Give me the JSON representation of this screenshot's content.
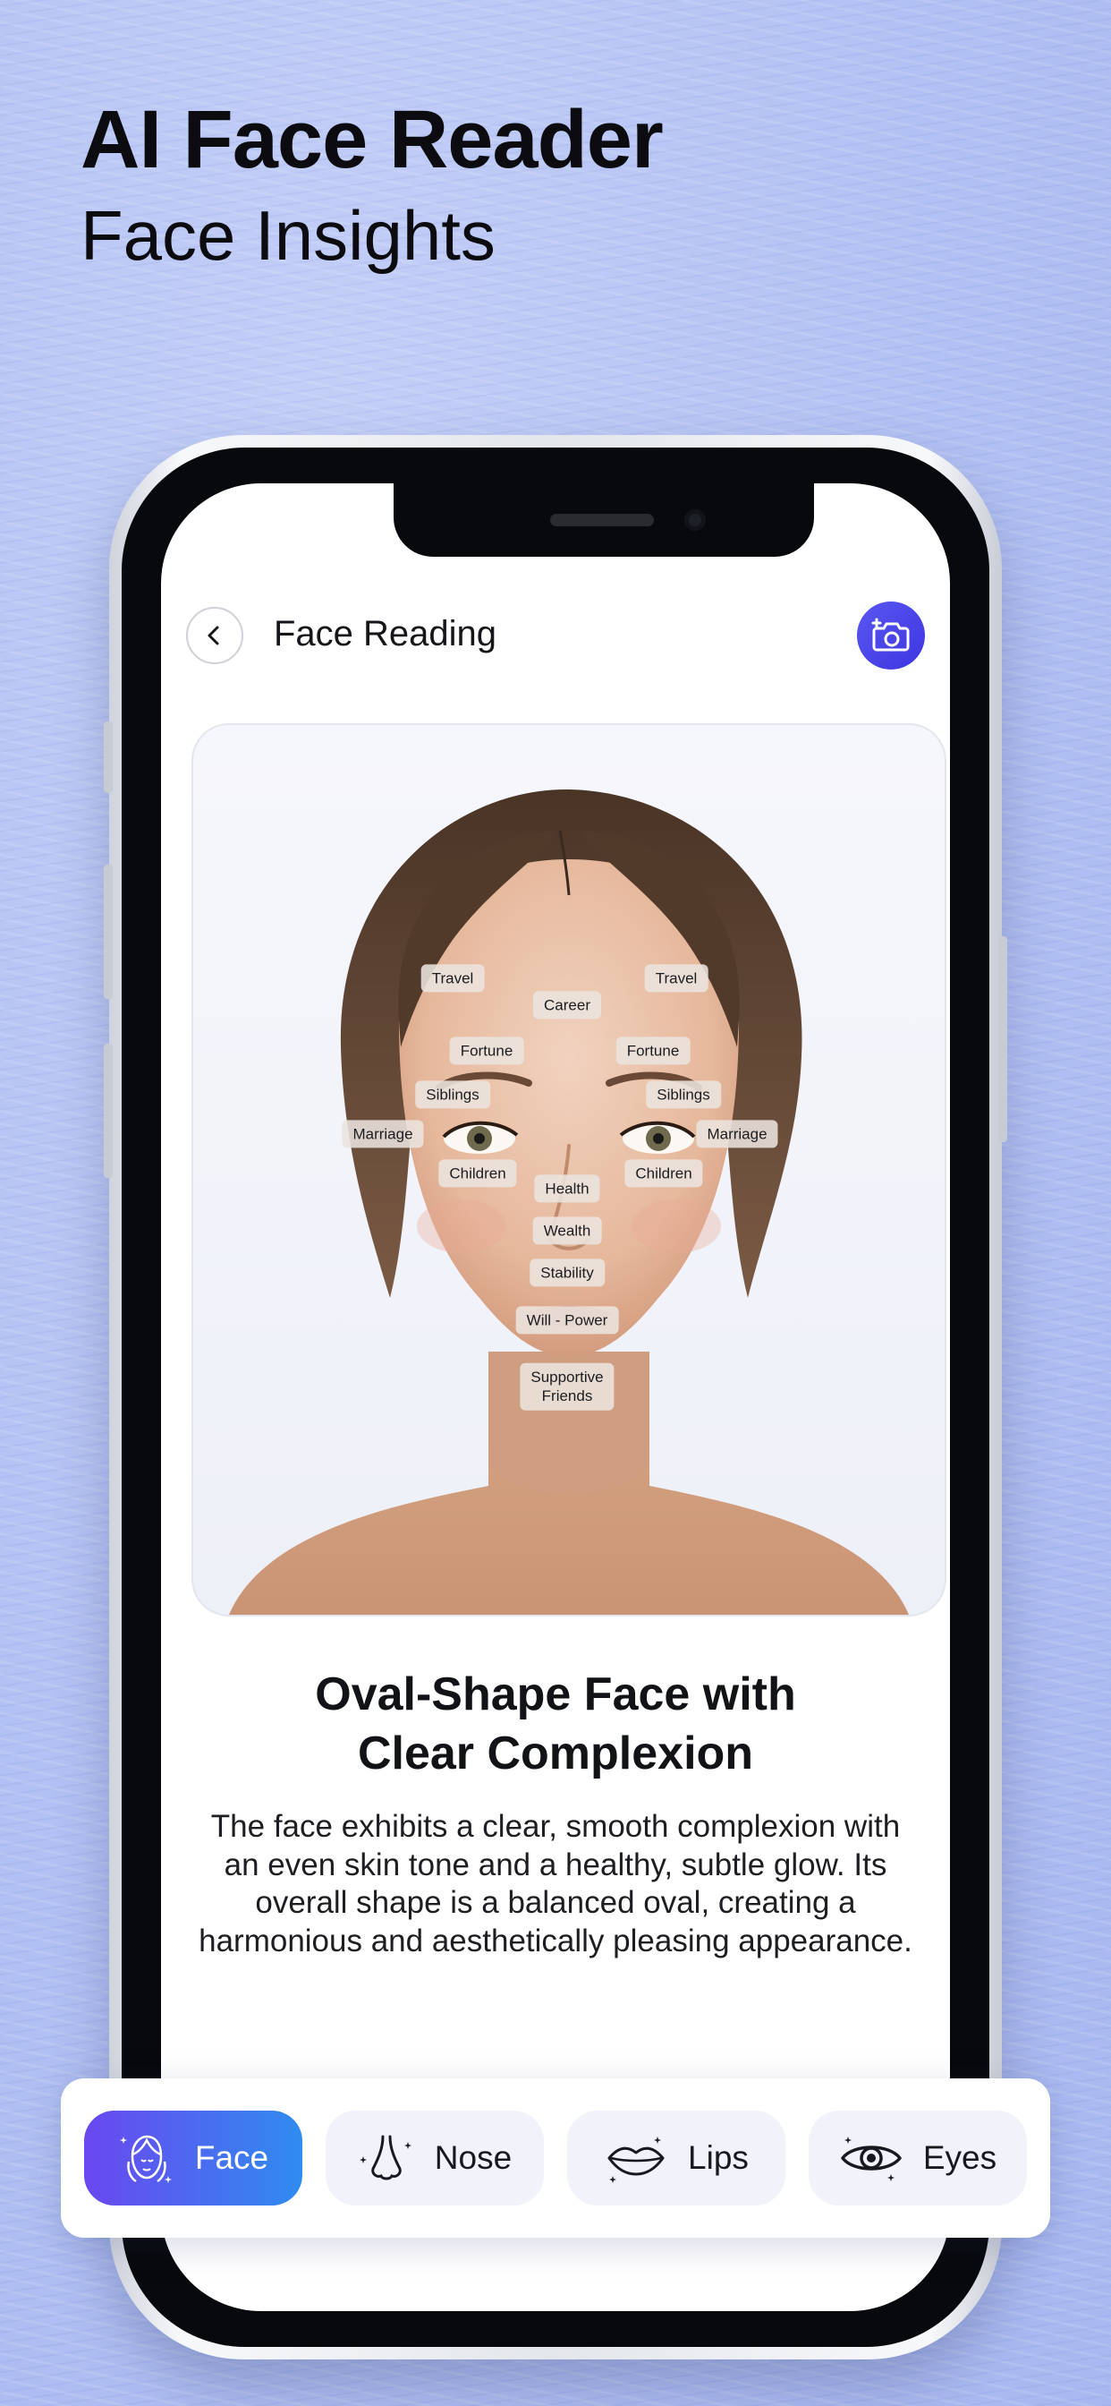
{
  "headline": {
    "title": "AI Face Reader",
    "subtitle": "Face Insights"
  },
  "app": {
    "screen_title": "Face Reading",
    "icons": {
      "back": "chevron-left-icon",
      "camera": "camera-add-icon"
    }
  },
  "face_map": {
    "labels": {
      "travel_left": "Travel",
      "travel_right": "Travel",
      "career": "Career",
      "fortune_left": "Fortune",
      "fortune_right": "Fortune",
      "siblings_left": "Siblings",
      "siblings_right": "Siblings",
      "marriage_left": "Marriage",
      "marriage_right": "Marriage",
      "children_left": "Children",
      "children_right": "Children",
      "health": "Health",
      "wealth": "Wealth",
      "stability": "Stability",
      "will_power": "Will - Power",
      "supportive_friends": "Supportive\nFriends"
    }
  },
  "result": {
    "title": "Oval-Shape Face with\nClear Complexion",
    "description": "The face exhibits a clear, smooth complexion with an even skin tone and a healthy, subtle glow. Its overall shape is a balanced oval, creating a harmonious and aesthetically pleasing appearance."
  },
  "tabs": [
    {
      "label": "Face",
      "icon": "face-icon",
      "active": true
    },
    {
      "label": "Nose",
      "icon": "nose-icon",
      "active": false
    },
    {
      "label": "Lips",
      "icon": "lips-icon",
      "active": false
    },
    {
      "label": "Eyes",
      "icon": "eye-icon",
      "active": false
    }
  ],
  "colors": {
    "accent": "#4a45ec",
    "tab_gradient_start": "#6a47f0",
    "tab_gradient_end": "#2f8cf0",
    "background": "#b4c3f4"
  }
}
